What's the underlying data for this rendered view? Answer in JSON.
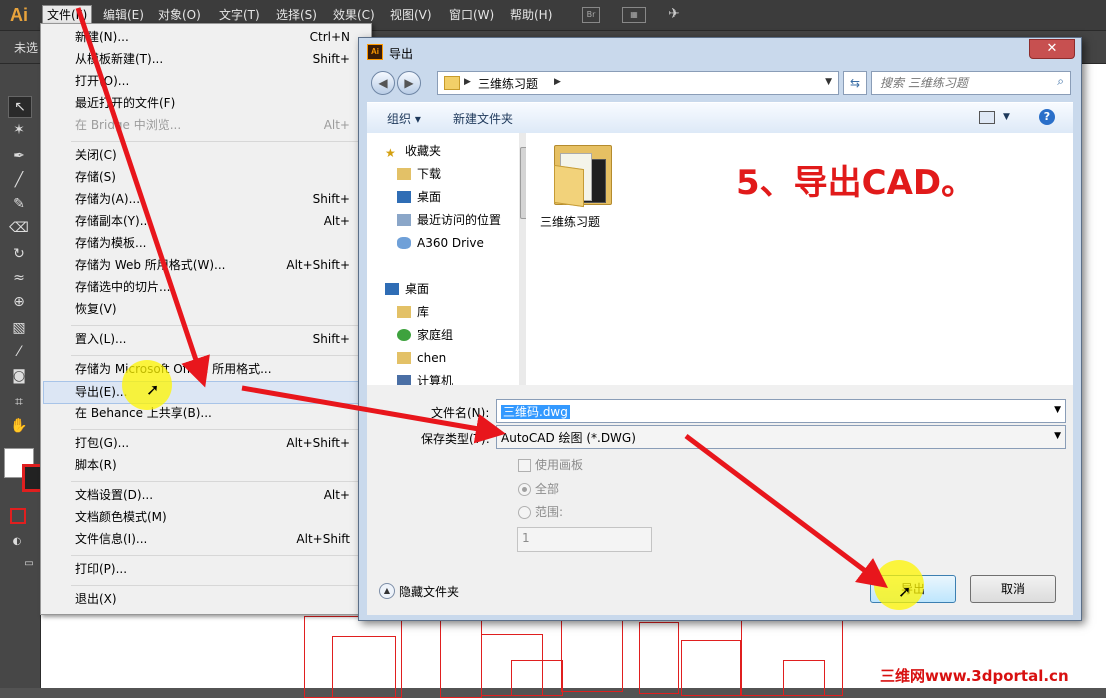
{
  "app": {
    "logo": "Ai"
  },
  "menubar": {
    "items": [
      "文件(F)",
      "编辑(E)",
      "对象(O)",
      "文字(T)",
      "选择(S)",
      "效果(C)",
      "视图(V)",
      "窗口(W)",
      "帮助(H)"
    ],
    "icons": [
      "bridge-icon",
      "workspace-layout-icon",
      "sync-icon"
    ]
  },
  "controlbar": {
    "selection_label": "未选"
  },
  "file_menu": {
    "items": [
      {
        "label": "新建(N)...",
        "shortcut": "Ctrl+N",
        "disabled": false
      },
      {
        "label": "从模板新建(T)...",
        "shortcut": "Shift+",
        "disabled": false
      },
      {
        "label": "打开(O)...",
        "shortcut": "",
        "disabled": false
      },
      {
        "label": "最近打开的文件(F)",
        "shortcut": "",
        "disabled": false
      },
      {
        "label": "在 Bridge 中浏览...",
        "shortcut": "Alt+",
        "disabled": true
      },
      {
        "label": "关闭(C)",
        "shortcut": "",
        "disabled": false
      },
      {
        "label": "存储(S)",
        "shortcut": "",
        "disabled": false
      },
      {
        "label": "存储为(A)...",
        "shortcut": "Shift+",
        "disabled": false
      },
      {
        "label": "存储副本(Y)...",
        "shortcut": "Alt+",
        "disabled": false
      },
      {
        "label": "存储为模板...",
        "shortcut": "",
        "disabled": false
      },
      {
        "label": "存储为 Web 所用格式(W)...",
        "shortcut": "Alt+Shift+",
        "disabled": false
      },
      {
        "label": "存储选中的切片...",
        "shortcut": "",
        "disabled": false
      },
      {
        "label": "恢复(V)",
        "shortcut": "",
        "disabled": false
      },
      {
        "label": "置入(L)...",
        "shortcut": "Shift+",
        "disabled": false
      },
      {
        "label": "存储为 Microsoft Office 所用格式...",
        "shortcut": "",
        "disabled": false
      },
      {
        "label": "导出(E)...",
        "shortcut": "",
        "disabled": false,
        "highlighted": true
      },
      {
        "label": "在 Behance 上共享(B)...",
        "shortcut": "",
        "disabled": false
      },
      {
        "label": "打包(G)...",
        "shortcut": "Alt+Shift+",
        "disabled": false
      },
      {
        "label": "脚本(R)",
        "shortcut": "",
        "disabled": false
      },
      {
        "label": "文档设置(D)...",
        "shortcut": "Alt+",
        "disabled": false
      },
      {
        "label": "文档颜色模式(M)",
        "shortcut": "",
        "disabled": false
      },
      {
        "label": "文件信息(I)...",
        "shortcut": "Alt+Shift",
        "disabled": false
      },
      {
        "label": "打印(P)...",
        "shortcut": "",
        "disabled": false
      },
      {
        "label": "退出(X)",
        "shortcut": "",
        "disabled": false
      }
    ]
  },
  "dialog": {
    "title": "导出",
    "close": "✕",
    "breadcrumb": "三维练习题",
    "search_placeholder": "搜索 三维练习题",
    "toolbar": {
      "organize": "组织 ▾",
      "new_folder": "新建文件夹"
    },
    "nav": {
      "favorites": "收藏夹",
      "favorites_items": [
        "下载",
        "桌面",
        "最近访问的位置",
        "A360 Drive"
      ],
      "desktop": "桌面",
      "desktop_items": [
        "库",
        "家庭组",
        "chen",
        "计算机"
      ]
    },
    "content": {
      "folder_name": "三维练习题"
    },
    "filename_label": "文件名(N):",
    "filename_value": "三维码.dwg",
    "filetype_label": "保存类型(T):",
    "filetype_value": "AutoCAD 绘图 (*.DWG)",
    "use_artboards_label": "使用画板",
    "all_label": "全部",
    "range_label": "范围:",
    "range_value": "1",
    "hide_folders": "隐藏文件夹",
    "export_button": "导出",
    "cancel_button": "取消"
  },
  "annotation": {
    "step_text": "5、导出CAD。"
  },
  "watermark": "三维网www.3dportal.cn",
  "colors": {
    "arrow": "#e8161c",
    "highlight": "#fff200",
    "step_text": "#e11a1a"
  }
}
